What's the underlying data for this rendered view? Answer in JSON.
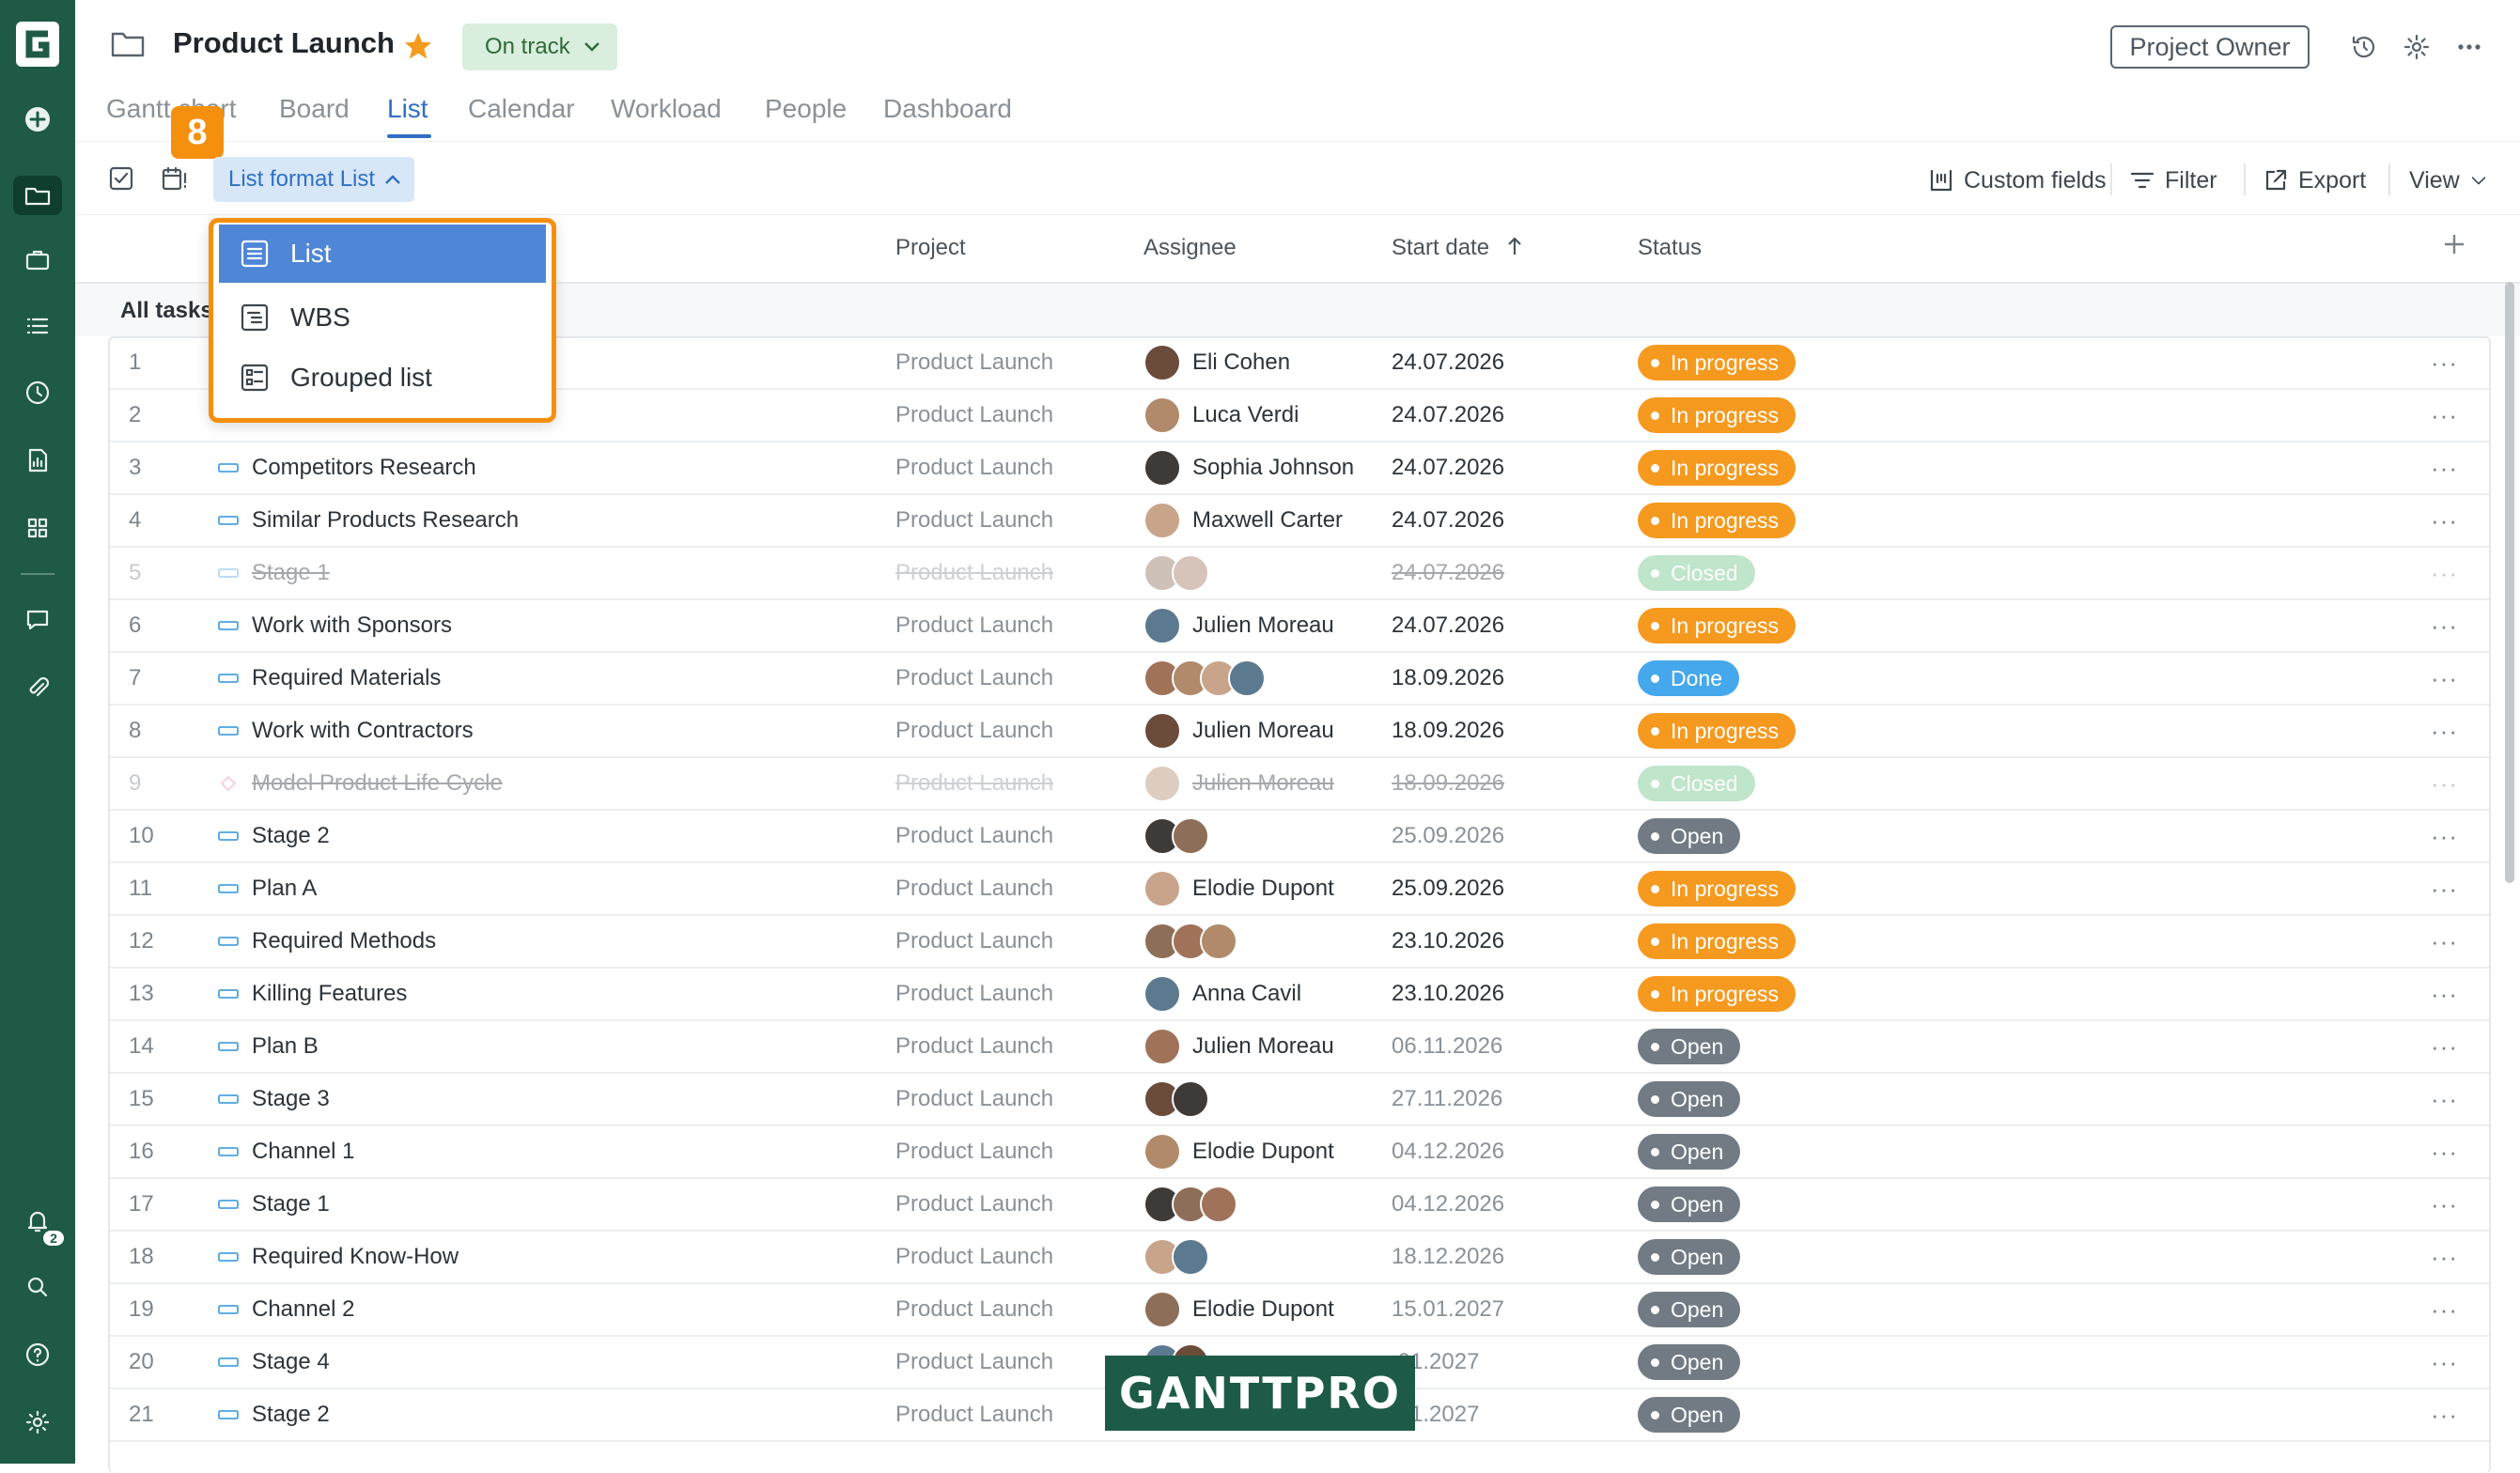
{
  "project": {
    "title": "Product Launch",
    "status_label": "On track"
  },
  "header": {
    "owner_button": "Project Owner",
    "notifications_count": "2"
  },
  "tabs": [
    "Gantt chart",
    "Board",
    "List",
    "Calendar",
    "Workload",
    "People",
    "Dashboard"
  ],
  "active_tab": "List",
  "toolbar": {
    "step_badge": "8",
    "list_format_label": "List format List",
    "custom_fields": "Custom fields",
    "filter": "Filter",
    "export": "Export",
    "view": "View"
  },
  "dropdown": {
    "items": [
      "List",
      "WBS",
      "Grouped list"
    ],
    "selected": "List"
  },
  "columns": {
    "project": "Project",
    "assignee": "Assignee",
    "start_date": "Start date",
    "status": "Status"
  },
  "group_label": "All tasks",
  "status_labels": {
    "inprogress": "In progress",
    "done": "Done",
    "open": "Open",
    "closed": "Closed"
  },
  "status_colors": {
    "inprogress": "#f59a1f",
    "done": "#46a8ec",
    "open": "#727b83",
    "closed": "#69c283",
    "accent": "#2f6fc4",
    "rail": "#1e5a46",
    "highlight": "#f5900f"
  },
  "rows": [
    {
      "num": "1",
      "name": "",
      "project": "Product Launch",
      "assignee": "Eli Cohen",
      "avatars": 1,
      "date": "24.07.2026",
      "status": "inprogress"
    },
    {
      "num": "2",
      "name": "",
      "project": "Product Launch",
      "assignee": "Luca Verdi",
      "avatars": 1,
      "date": "24.07.2026",
      "status": "inprogress"
    },
    {
      "num": "3",
      "name": "Competitors Research",
      "project": "Product Launch",
      "assignee": "Sophia Johnson",
      "avatars": 1,
      "date": "24.07.2026",
      "status": "inprogress"
    },
    {
      "num": "4",
      "name": "Similar Products Research",
      "project": "Product Launch",
      "assignee": "Maxwell Carter",
      "avatars": 1,
      "date": "24.07.2026",
      "status": "inprogress"
    },
    {
      "num": "5",
      "name": "Stage 1",
      "project": "Product Launch",
      "assignee": "",
      "avatars": 2,
      "date": "24.07.2026",
      "status": "closed"
    },
    {
      "num": "6",
      "name": "Work with Sponsors",
      "project": "Product Launch",
      "assignee": "Julien Moreau",
      "avatars": 1,
      "date": "24.07.2026",
      "status": "inprogress"
    },
    {
      "num": "7",
      "name": "Required Materials",
      "project": "Product Launch",
      "assignee": "",
      "avatars": 4,
      "date": "18.09.2026",
      "status": "done"
    },
    {
      "num": "8",
      "name": "Work with Contractors",
      "project": "Product Launch",
      "assignee": "Julien Moreau",
      "avatars": 1,
      "date": "18.09.2026",
      "status": "inprogress"
    },
    {
      "num": "9",
      "name": "Model Product Life Cycle",
      "project": "Product Launch",
      "assignee": "Julien Moreau",
      "avatars": 1,
      "date": "18.09.2026",
      "status": "closed",
      "milestone": true
    },
    {
      "num": "10",
      "name": "Stage 2",
      "project": "Product Launch",
      "assignee": "",
      "avatars": 2,
      "date": "25.09.2026",
      "status": "open"
    },
    {
      "num": "11",
      "name": "Plan A",
      "project": "Product Launch",
      "assignee": "Elodie Dupont",
      "avatars": 1,
      "date": "25.09.2026",
      "status": "inprogress"
    },
    {
      "num": "12",
      "name": "Required Methods",
      "project": "Product Launch",
      "assignee": "",
      "avatars": 3,
      "date": "23.10.2026",
      "status": "inprogress"
    },
    {
      "num": "13",
      "name": "Killing Features",
      "project": "Product Launch",
      "assignee": "Anna Cavil",
      "avatars": 1,
      "date": "23.10.2026",
      "status": "inprogress"
    },
    {
      "num": "14",
      "name": "Plan B",
      "project": "Product Launch",
      "assignee": "Julien Moreau",
      "avatars": 1,
      "date": "06.11.2026",
      "status": "open"
    },
    {
      "num": "15",
      "name": "Stage 3",
      "project": "Product Launch",
      "assignee": "",
      "avatars": 2,
      "date": "27.11.2026",
      "status": "open"
    },
    {
      "num": "16",
      "name": "Channel 1",
      "project": "Product Launch",
      "assignee": "Elodie Dupont",
      "avatars": 1,
      "date": "04.12.2026",
      "status": "open"
    },
    {
      "num": "17",
      "name": "Stage 1",
      "project": "Product Launch",
      "assignee": "",
      "avatars": 3,
      "date": "04.12.2026",
      "status": "open"
    },
    {
      "num": "18",
      "name": "Required Know-How",
      "project": "Product Launch",
      "assignee": "",
      "avatars": 2,
      "date": "18.12.2026",
      "status": "open"
    },
    {
      "num": "19",
      "name": "Channel 2",
      "project": "Product Launch",
      "assignee": "Elodie Dupont",
      "avatars": 1,
      "date": "15.01.2027",
      "status": "open"
    },
    {
      "num": "20",
      "name": "Stage 4",
      "project": "Product Launch",
      "assignee": "",
      "avatars": 2,
      "date": ".01.2027",
      "status": "open"
    },
    {
      "num": "21",
      "name": "Stage 2",
      "project": "Product Launch",
      "assignee": "",
      "avatars": 0,
      "date": ".01.2027",
      "status": "open"
    }
  ],
  "watermark": "GANTTPRO"
}
